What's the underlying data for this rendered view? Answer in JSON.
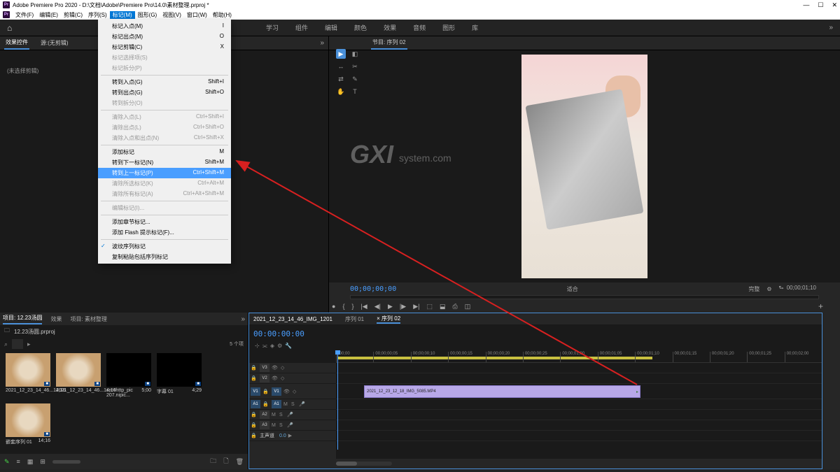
{
  "app": {
    "title": "Adobe Premiere Pro 2020 - D:\\文档\\Adobe\\Premiere Pro\\14.0\\素材整理.prproj *"
  },
  "menu": {
    "file": "文件(F)",
    "edit": "编辑(E)",
    "clip": "剪辑(C)",
    "sequence": "序列(S)",
    "marker": "标记(M)",
    "graphics": "图形(G)",
    "view": "视图(V)",
    "window": "窗口(W)",
    "help": "帮助(H)"
  },
  "workspaces": {
    "w1": "学习",
    "w2": "组件",
    "w3": "编辑",
    "w4": "颜色",
    "w5": "效果",
    "w6": "音频",
    "w7": "图形",
    "w8": "库"
  },
  "dropdown": {
    "i1": {
      "l": "标记入点(M)",
      "s": "I"
    },
    "i2": {
      "l": "标记出点(M)",
      "s": "O"
    },
    "i3": {
      "l": "标记剪辑(C)",
      "s": "X"
    },
    "i4": {
      "l": "标记选择项(S)"
    },
    "i5": {
      "l": "标记拆分(P)"
    },
    "i6": {
      "l": "转到入点(G)",
      "s": "Shift+I"
    },
    "i7": {
      "l": "转到出点(G)",
      "s": "Shift+O"
    },
    "i8": {
      "l": "转到拆分(O)"
    },
    "i9": {
      "l": "清除入点(L)",
      "s": "Ctrl+Shift+I"
    },
    "i10": {
      "l": "清除出点(L)",
      "s": "Ctrl+Shift+O"
    },
    "i11": {
      "l": "清除入点和出点(N)",
      "s": "Ctrl+Shift+X"
    },
    "i12": {
      "l": "添加标记",
      "s": "M"
    },
    "i13": {
      "l": "转到下一标记(N)",
      "s": "Shift+M"
    },
    "i14": {
      "l": "转到上一标记(P)",
      "s": "Ctrl+Shift+M"
    },
    "i15": {
      "l": "清除所选标记(K)",
      "s": "Ctrl+Alt+M"
    },
    "i16": {
      "l": "清除所有标记(A)",
      "s": "Ctrl+Alt+Shift+M"
    },
    "i17": {
      "l": "编辑标记(I)..."
    },
    "i18": {
      "l": "添加章节标记..."
    },
    "i19": {
      "l": "添加 Flash 提示标记(F)..."
    },
    "i20": {
      "l": "波纹序列标记"
    },
    "i21": {
      "l": "复制粘贴包括序列标记"
    }
  },
  "effCtrl": {
    "tab1": "效果控件",
    "tab2": "源:(无剪辑)",
    "empty": "(未选择剪辑)"
  },
  "program": {
    "tab": "节目: 序列 02",
    "tc": "00;00;00;00",
    "fit": "适合",
    "dur": "00;00;01;10",
    "full": "完整"
  },
  "project": {
    "tab1": "项目: 12.23汤圆",
    "tab2": "效果",
    "tab3": "项目: 素材整理",
    "bin": "12.23汤圆.prproj",
    "count": "5 个项",
    "b1": {
      "n": "2021_12_23_14_46...",
      "d": "14;16"
    },
    "b2": {
      "n": "2021_12_23_14_46...",
      "d": "14;16"
    },
    "b3": {
      "n": "src=http_pic 207.nipic...",
      "d": "5;00"
    },
    "b4": {
      "n": "字幕 01",
      "d": "4;29"
    },
    "b5": {
      "n": "嵌套序列 01",
      "d": "14;16"
    }
  },
  "timeline": {
    "src": "2021_12_23_14_46_IMG_1201",
    "tab1": "序列 01",
    "tab2": "× 序列 02",
    "tc": "00:00:00:00",
    "r": {
      "t0": ";00;00",
      "t1": "00;00;00;05",
      "t2": "00;00;00;10",
      "t3": "00;00;00;15",
      "t4": "00;00;00;20",
      "t5": "00;00;00;25",
      "t6": "00;00;01;00",
      "t7": "00;00;01;05",
      "t8": "00;00;01;10",
      "t9": "00;00;01;15",
      "t10": "00;00;01;20",
      "t11": "00;00;01;25",
      "t12": "00;00;02;00"
    },
    "v3": "V3",
    "v2": "V2",
    "v1": "V1",
    "a1": "A1",
    "a2": "A2",
    "a3": "A3",
    "master": "主声道",
    "masterval": "0.0",
    "clip": "2021_12_23_12_18_IMG_5085.MP4",
    "srcV1": "V1",
    "srcA1": "A1"
  }
}
